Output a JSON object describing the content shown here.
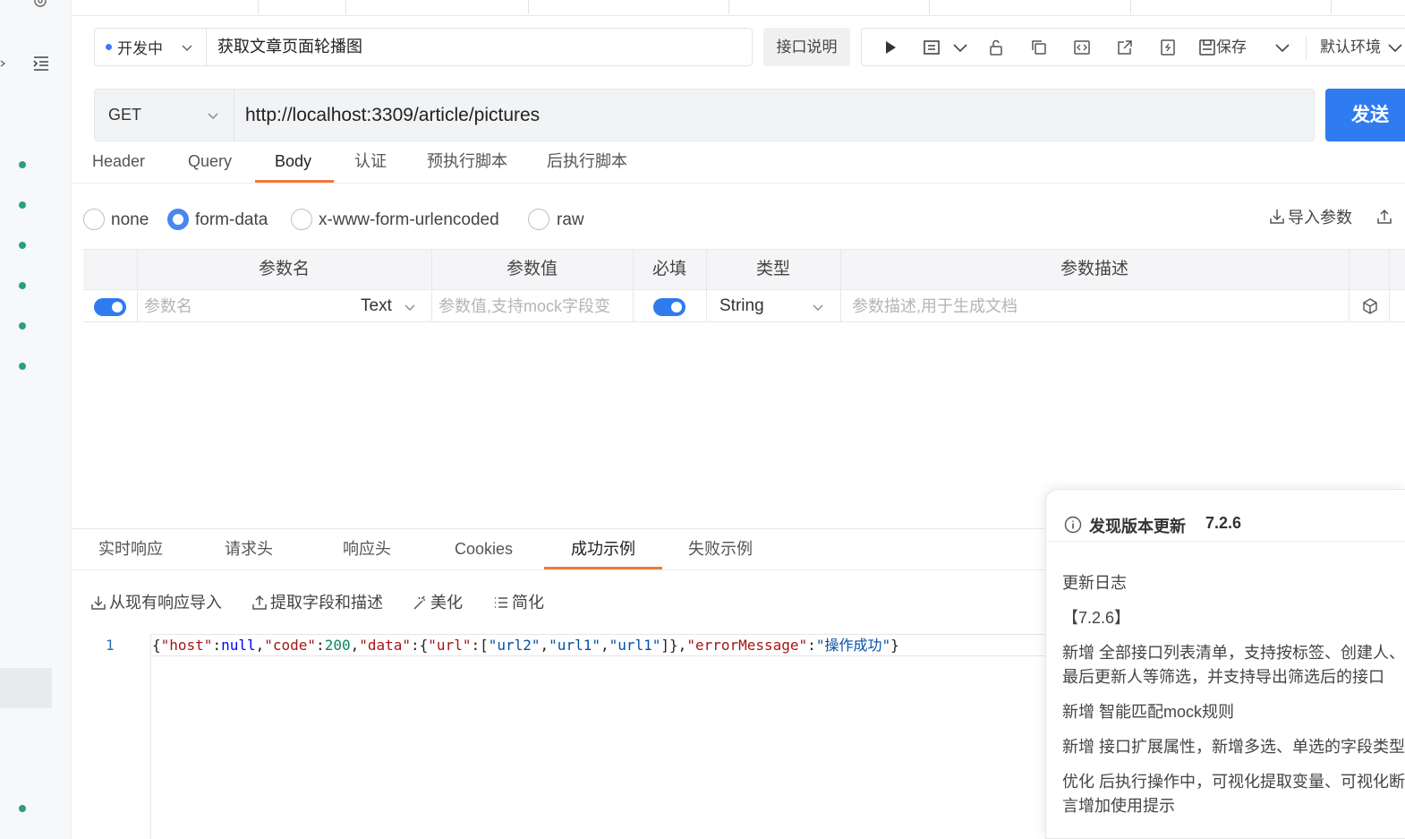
{
  "status": {
    "label": "开发中"
  },
  "api": {
    "name": "获取文章页面轮播图",
    "doc_button": "接口说明",
    "save_label": "保存",
    "env_label": "默认环境",
    "method": "GET",
    "url": "http://localhost:3309/article/pictures",
    "send_label": "发送"
  },
  "request_tabs": [
    "Header",
    "Query",
    "Body",
    "认证",
    "预执行脚本",
    "后执行脚本"
  ],
  "active_request_tab": "Body",
  "body_types": [
    "none",
    "form-data",
    "x-www-form-urlencoded",
    "raw"
  ],
  "active_body_type": "form-data",
  "import_params_label": "导入参数",
  "params_table": {
    "headers": [
      "参数名",
      "参数值",
      "必填",
      "类型",
      "参数描述"
    ],
    "row": {
      "name_placeholder": "参数名",
      "name_type": "Text",
      "value_placeholder": "参数值,支持mock字段变",
      "required": true,
      "type": "String",
      "desc_placeholder": "参数描述,用于生成文档"
    }
  },
  "response_tabs": [
    "实时响应",
    "请求头",
    "响应头",
    "Cookies",
    "成功示例",
    "失败示例"
  ],
  "active_response_tab": "成功示例",
  "response_tools": [
    "从现有响应导入",
    "提取字段和描述",
    "美化",
    "简化"
  ],
  "code": {
    "line_number": "1",
    "tokens": [
      {
        "t": "{",
        "c": "p"
      },
      {
        "t": "\"host\"",
        "c": "k"
      },
      {
        "t": ":",
        "c": "p"
      },
      {
        "t": "null",
        "c": "kw"
      },
      {
        "t": ",",
        "c": "p"
      },
      {
        "t": "\"code\"",
        "c": "k"
      },
      {
        "t": ":",
        "c": "p"
      },
      {
        "t": "200",
        "c": "n"
      },
      {
        "t": ",",
        "c": "p"
      },
      {
        "t": "\"data\"",
        "c": "k"
      },
      {
        "t": ":{",
        "c": "p"
      },
      {
        "t": "\"url\"",
        "c": "k"
      },
      {
        "t": ":[",
        "c": "p"
      },
      {
        "t": "\"url2\"",
        "c": "s"
      },
      {
        "t": ",",
        "c": "p"
      },
      {
        "t": "\"url1\"",
        "c": "s"
      },
      {
        "t": ",",
        "c": "p"
      },
      {
        "t": "\"url1\"",
        "c": "s"
      },
      {
        "t": "]},",
        "c": "p"
      },
      {
        "t": "\"errorMessage\"",
        "c": "k"
      },
      {
        "t": ":",
        "c": "p"
      },
      {
        "t": "\"操作成功\"",
        "c": "s"
      },
      {
        "t": "}",
        "c": "p"
      }
    ]
  },
  "update_panel": {
    "title": "发现版本更新",
    "version": "7.2.6",
    "lines": [
      "更新日志",
      "【7.2.6】",
      "新增 全部接口列表清单，支持按标签、创建人、",
      "最后更新人等筛选，并支持导出筛选后的接口",
      "新增 智能匹配mock规则",
      "新增 接口扩展属性，新增多选、单选的字段类型",
      "优化 后执行操作中，可视化提取变量、可视化断",
      "言增加使用提示"
    ]
  },
  "colors": {
    "accent_blue": "#2f7bf0",
    "tab_active": "#f07a3a",
    "status_dot": "#3a7cf5"
  }
}
